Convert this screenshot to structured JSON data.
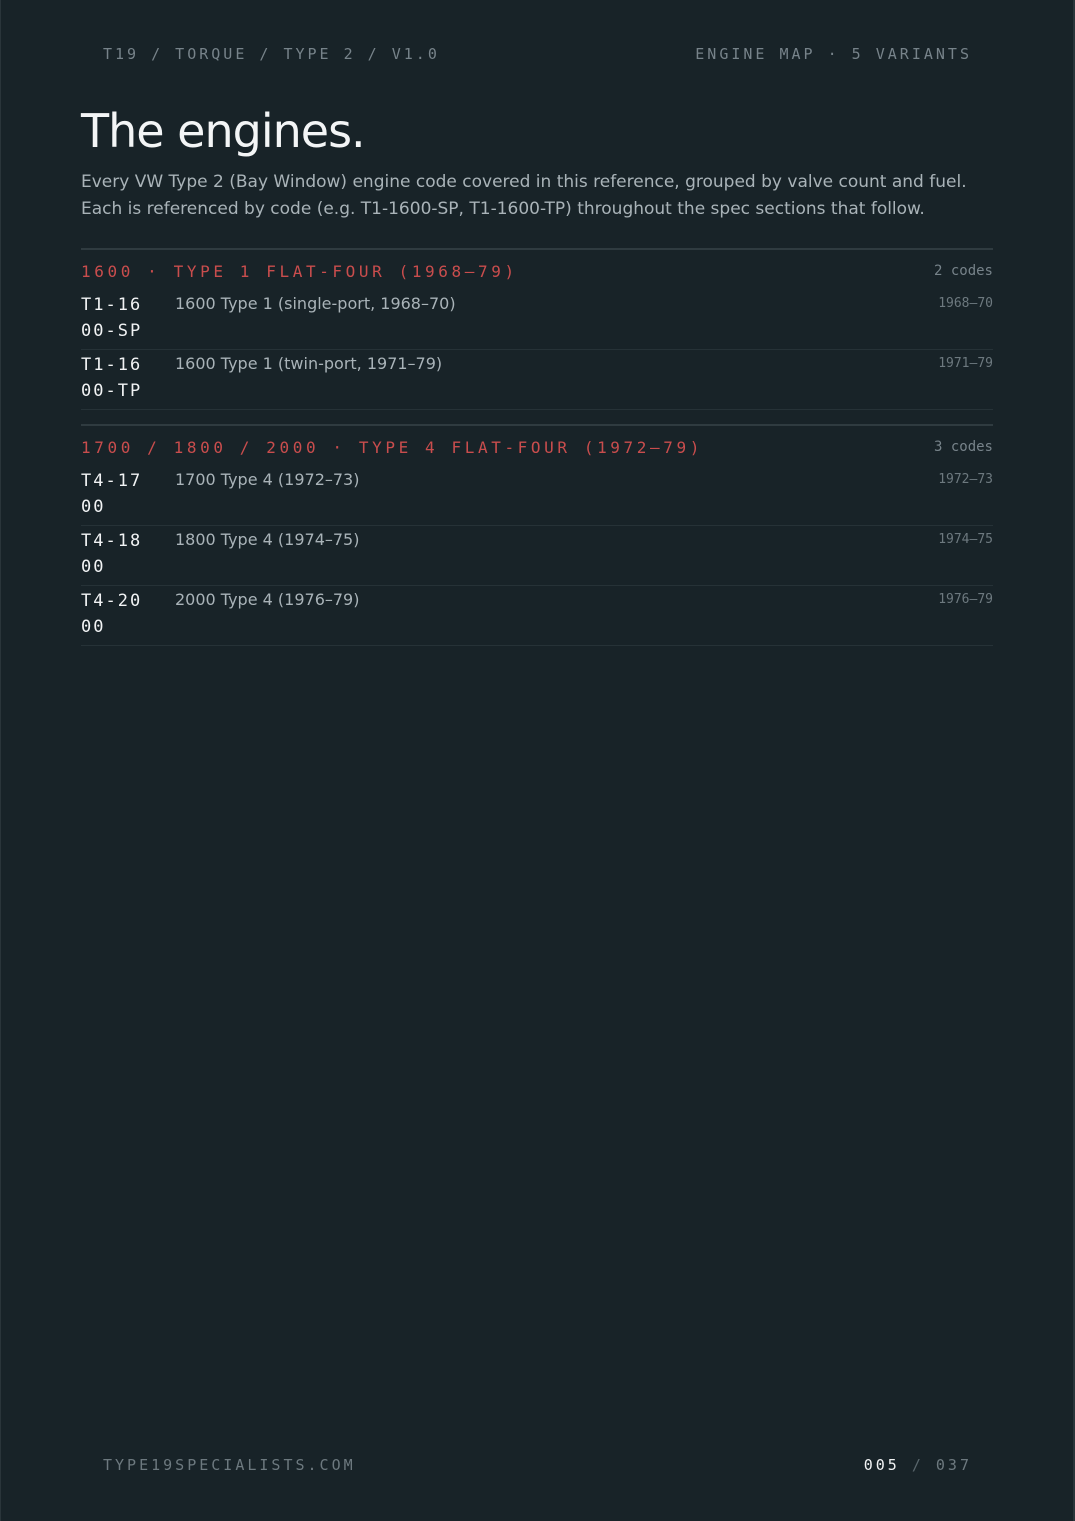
{
  "header": {
    "breadcrumb": "T19 / TORQUE / TYPE 2 / V1.0",
    "section_label": "ENGINE MAP · 5 VARIANTS"
  },
  "title": "The engines.",
  "intro": "Every VW Type 2 (Bay Window) engine code covered in this reference, grouped by valve count and fuel. Each is referenced by code (e.g. T1-1600-SP, T1-1600-TP) throughout the spec sections that follow.",
  "groups": [
    {
      "title": "1600 · TYPE 1 FLAT-FOUR (1968–79)",
      "count": "2 codes",
      "engines": [
        {
          "code": "T1-1600-SP",
          "description": "1600 Type 1 (single-port, 1968–70)",
          "years": "1968–70"
        },
        {
          "code": "T1-1600-TP",
          "description": "1600 Type 1 (twin-port, 1971–79)",
          "years": "1971–79"
        }
      ]
    },
    {
      "title": "1700 / 1800 / 2000 · TYPE 4 FLAT-FOUR (1972–79)",
      "count": "3 codes",
      "engines": [
        {
          "code": "T4-1700",
          "description": "1700 Type 4 (1972–73)",
          "years": "1972–73"
        },
        {
          "code": "T4-1800",
          "description": "1800 Type 4 (1974–75)",
          "years": "1974–75"
        },
        {
          "code": "T4-2000",
          "description": "2000 Type 4 (1976–79)",
          "years": "1976–79"
        }
      ]
    }
  ],
  "footer": {
    "site": "TYPE19SPECIALISTS.COM",
    "page_current": "005",
    "page_separator": "/",
    "page_total": "037"
  },
  "colors": {
    "background": "#182328",
    "accent": "#c94d4d",
    "text_primary": "#f1f3f4",
    "text_secondary": "#a9b3b8",
    "text_muted": "#77838a"
  }
}
